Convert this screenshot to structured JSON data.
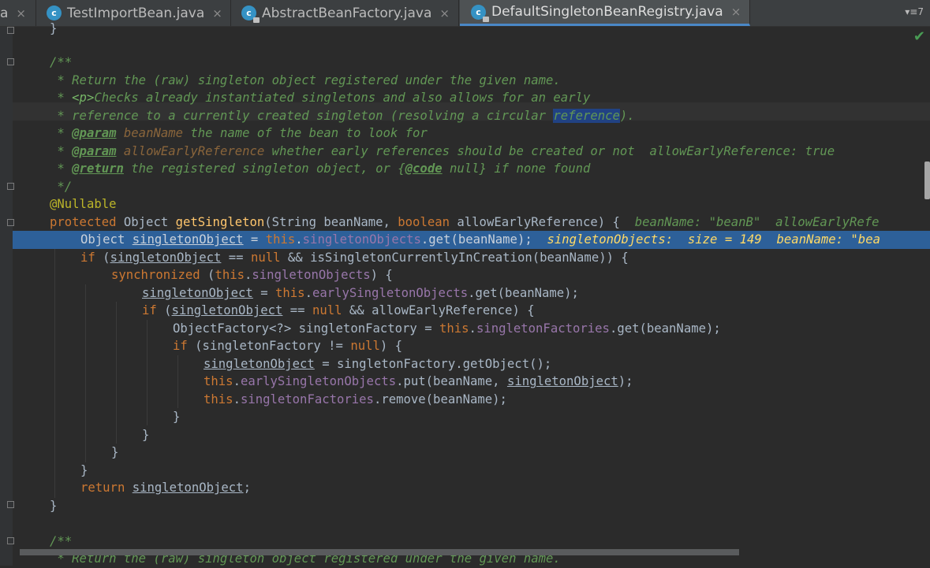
{
  "tabs": {
    "partial_label": "a",
    "items": [
      {
        "label": "TestImportBean.java",
        "icon": "class-icon",
        "active": false
      },
      {
        "label": "AbstractBeanFactory.java",
        "icon": "abstract-class-icon",
        "active": false
      },
      {
        "label": "DefaultSingletonBeanRegistry.java",
        "icon": "abstract-class-icon",
        "active": true
      }
    ],
    "overflow_label": "▾≡7",
    "close_glyph": "×",
    "icon_letter": "c"
  },
  "editor": {
    "lines": {
      "l00_brace": "}",
      "l02_open": "/**",
      "l03": " * Return the (raw) singleton object registered under the given name.",
      "l04_pre": " * ",
      "l04_tag": "<p>",
      "l04_post": "Checks already instantiated singletons and also allows for an early",
      "l05_pre": " * reference to a currently created singleton (resolving a circular ",
      "l05_sel": "reference",
      "l05_post": ").",
      "l06_pre": " * ",
      "l06_tag": "@param",
      "l06_name": " beanName",
      "l06_post": " the name of the bean to look for",
      "l07_pre": " * ",
      "l07_tag": "@param",
      "l07_name": " allowEarlyReference",
      "l07_post": " whether early references should be created or not",
      "l07_hint": "allowEarlyReference: true",
      "l08_pre": " * ",
      "l08_tag": "@return",
      "l08_mid": " the registered singleton object, or {",
      "l08_code": "@code",
      "l08_post": " null} if none found",
      "l09": " */",
      "l10": "@Nullable",
      "l11_kw": "protected",
      "l11_a": " Object ",
      "l11_m": "getSingleton",
      "l11_b": "(String beanName, ",
      "l11_kw2": "boolean",
      "l11_c": " allowEarlyReference) {",
      "l11_hint": "beanName: \"beanB\"  allowEarlyRefe",
      "l12_a": "Object ",
      "l12_v": "singletonObject",
      "l12_b": " = ",
      "l12_this": "this",
      "l12_c": ".",
      "l12_f": "singletonObjects",
      "l12_d": ".get(beanName);",
      "l12_hint": "singletonObjects:  size = 149  beanName: \"bea",
      "l13_kw": "if",
      "l13_a": " (",
      "l13_v": "singletonObject",
      "l13_b": " == ",
      "l13_null": "null",
      "l13_c": " && isSingletonCurrentlyInCreation(beanName)) {",
      "l14_kw": "synchronized",
      "l14_a": " (",
      "l14_this": "this",
      "l14_b": ".",
      "l14_f": "singletonObjects",
      "l14_c": ") {",
      "l15_v": "singletonObject",
      "l15_a": " = ",
      "l15_this": "this",
      "l15_b": ".",
      "l15_f": "earlySingletonObjects",
      "l15_c": ".get(beanName);",
      "l16_kw": "if",
      "l16_a": " (",
      "l16_v": "singletonObject",
      "l16_b": " == ",
      "l16_null": "null",
      "l16_c": " && allowEarlyReference) {",
      "l17_a": "ObjectFactory<?> singletonFactory = ",
      "l17_this": "this",
      "l17_b": ".",
      "l17_f": "singletonFactories",
      "l17_c": ".get(beanName);",
      "l18_kw": "if",
      "l18_a": " (singletonFactory != ",
      "l18_null": "null",
      "l18_b": ") {",
      "l19_v": "singletonObject",
      "l19_a": " = singletonFactory.getObject();",
      "l20_this": "this",
      "l20_a": ".",
      "l20_f": "earlySingletonObjects",
      "l20_b": ".put(beanName, ",
      "l20_v": "singletonObject",
      "l20_c": ");",
      "l21_this": "this",
      "l21_a": ".",
      "l21_f": "singletonFactories",
      "l21_b": ".remove(beanName);",
      "brace": "}",
      "l26_kw": "return",
      "l26_a": " ",
      "l26_v": "singletonObject",
      "l26_b": ";",
      "l29": "/**",
      "l30": " * Return the (raw) singleton object registered under the given name."
    }
  },
  "status": {
    "check": "✔"
  },
  "colors": {
    "background": "#2b2b2b",
    "keyword": "#cc7832",
    "doc_comment": "#629755",
    "field": "#9876aa",
    "method": "#ffc66d",
    "execution_line": "#2d6099",
    "annotation": "#bbb529"
  }
}
